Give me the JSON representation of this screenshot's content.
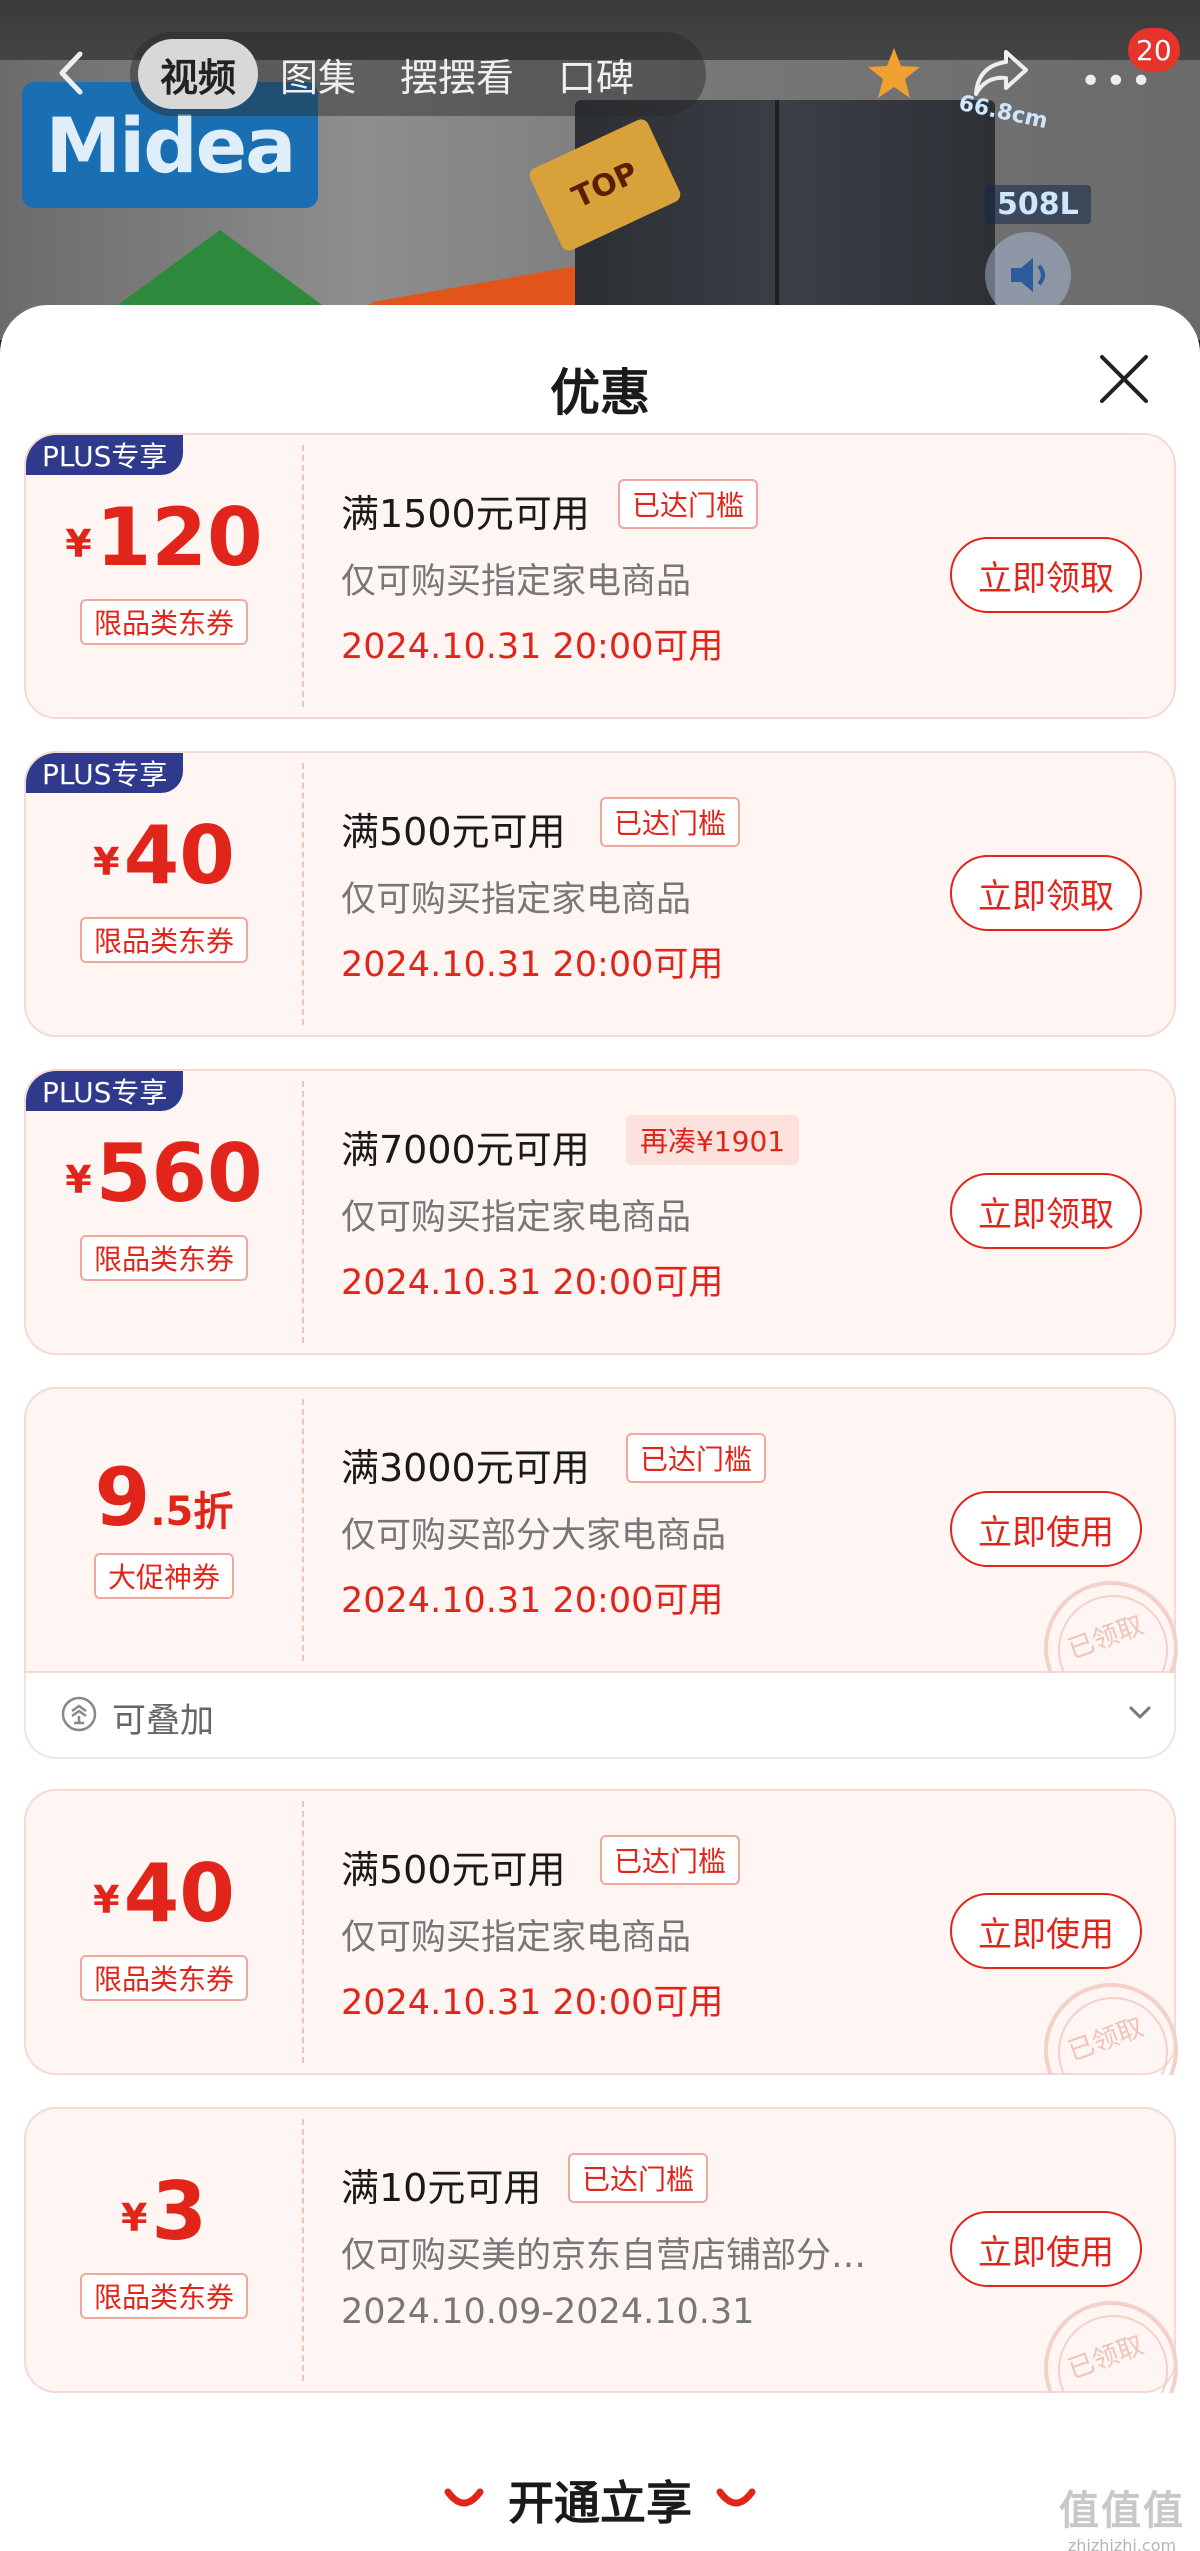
{
  "hero": {
    "brand_logo": "Midea",
    "badge": "TOP",
    "dimension": "66.8cm",
    "capacity": "508L"
  },
  "topnav": {
    "tabs": [
      {
        "label": "视频",
        "active": true
      },
      {
        "label": "图集",
        "active": false
      },
      {
        "label": "摆摆看",
        "active": false
      },
      {
        "label": "口碑",
        "active": false
      }
    ],
    "message_count": "20"
  },
  "sheet": {
    "title": "优惠"
  },
  "coupons": [
    {
      "plus_tag": "PLUS专享",
      "currency": "¥",
      "amount": "120",
      "kind": "限品类东券",
      "title": "满1500元可用",
      "status": "已达门槛",
      "scope": "仅可购买指定家电商品",
      "date": "2024.10.31 20:00可用",
      "action": "立即领取"
    },
    {
      "plus_tag": "PLUS专享",
      "currency": "¥",
      "amount": "40",
      "kind": "限品类东券",
      "title": "满500元可用",
      "status": "已达门槛",
      "scope": "仅可购买指定家电商品",
      "date": "2024.10.31 20:00可用",
      "action": "立即领取"
    },
    {
      "plus_tag": "PLUS专享",
      "currency": "¥",
      "amount": "560",
      "kind": "限品类东券",
      "title": "满7000元可用",
      "status": "再凑¥1901",
      "scope": "仅可购买指定家电商品",
      "date": "2024.10.31 20:00可用",
      "action": "立即领取"
    },
    {
      "amount_main": "9",
      "amount_sub": ".5折",
      "kind": "大促神券",
      "title": "满3000元可用",
      "status": "已达门槛",
      "scope": "仅可购买部分大家电商品",
      "date": "2024.10.31 20:00可用",
      "action": "立即使用",
      "stamp": "已领取",
      "stack_label": "可叠加"
    },
    {
      "currency": "¥",
      "amount": "40",
      "kind": "限品类东券",
      "title": "满500元可用",
      "status": "已达门槛",
      "scope": "仅可购买指定家电商品",
      "date": "2024.10.31 20:00可用",
      "action": "立即使用",
      "stamp": "已领取"
    },
    {
      "currency": "¥",
      "amount": "3",
      "kind": "限品类东券",
      "title": "满10元可用",
      "status": "已达门槛",
      "scope": "仅可购买美的京东自营店铺部分…",
      "date": "2024.10.09-2024.10.31",
      "action": "立即使用",
      "stamp": "已领取"
    }
  ],
  "bottom": {
    "cta": "开通立享"
  },
  "watermark": {
    "big": "值值值",
    "small": "zhizhizhi.com"
  },
  "colors": {
    "accent": "#e1251b",
    "plus_tag": "#2f3a8c",
    "coupon_bg": "#fff6f4"
  }
}
